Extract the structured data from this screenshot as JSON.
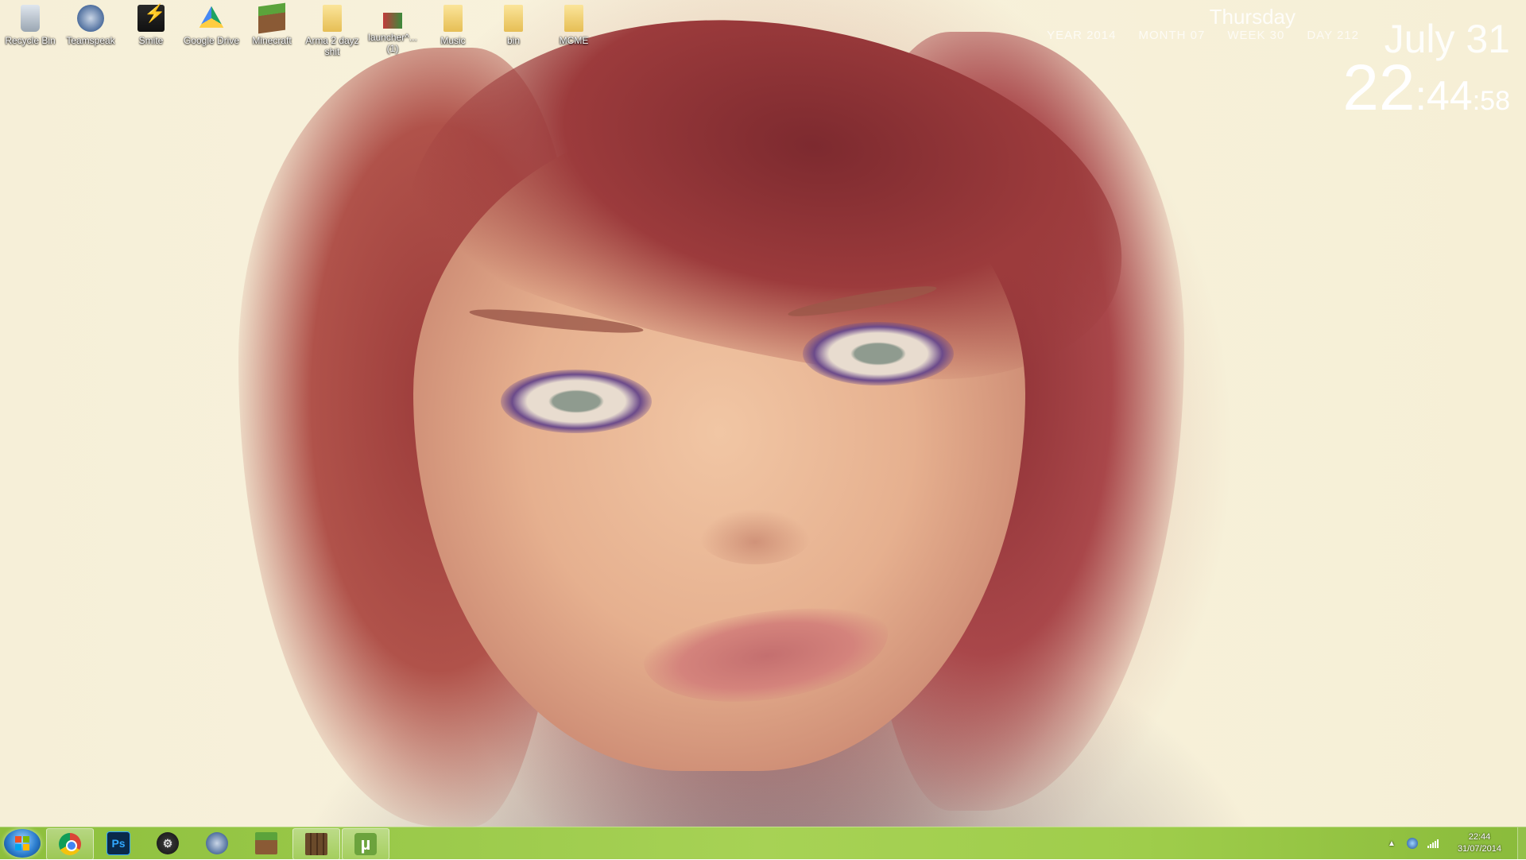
{
  "desktop": {
    "icons": [
      {
        "label": "Recycle Bin",
        "icon": "recycle-bin-icon"
      },
      {
        "label": "Teamspeak",
        "icon": "teamspeak-icon"
      },
      {
        "label": "Smite",
        "icon": "smite-icon"
      },
      {
        "label": "Google Drive",
        "icon": "google-drive-icon"
      },
      {
        "label": "Minecraft",
        "icon": "minecraft-icon"
      },
      {
        "label": "Arma 2 dayz shit",
        "icon": "folder-icon"
      },
      {
        "label": "launcher^... (1)",
        "icon": "launcher-icon"
      },
      {
        "label": "Music",
        "icon": "folder-icon"
      },
      {
        "label": "bin",
        "icon": "folder-icon"
      },
      {
        "label": "MCME",
        "icon": "folder-icon"
      }
    ]
  },
  "clock_widget": {
    "day_name": "Thursday",
    "year": "YEAR 2014",
    "month": "MONTH 07",
    "week": "WEEK 30",
    "day_of_year": "DAY 212",
    "month_day": "July 31",
    "hour": "22",
    "minute": ":44",
    "second": ":58"
  },
  "taskbar": {
    "start_icon": "windows-start-icon",
    "pinned": [
      {
        "name": "chrome",
        "icon": "chrome-icon",
        "text": "",
        "active": true
      },
      {
        "name": "photoshop",
        "icon": "photoshop-icon",
        "text": "Ps",
        "active": false
      },
      {
        "name": "steam",
        "icon": "steam-icon",
        "text": "",
        "active": false
      },
      {
        "name": "teamspeak",
        "icon": "teamspeak-icon",
        "text": "",
        "active": false
      },
      {
        "name": "minecraft",
        "icon": "minecraft-icon",
        "text": "",
        "active": false
      },
      {
        "name": "mcedit",
        "icon": "mcedit-icon",
        "text": "",
        "active": true
      },
      {
        "name": "utorrent",
        "icon": "utorrent-icon",
        "text": "µ",
        "active": true
      }
    ],
    "tray": {
      "time": "22:44",
      "date": "31/07/2014"
    }
  },
  "colors": {
    "taskbar": "#9ac94a",
    "wallpaper_bg": "#f6efd8"
  }
}
